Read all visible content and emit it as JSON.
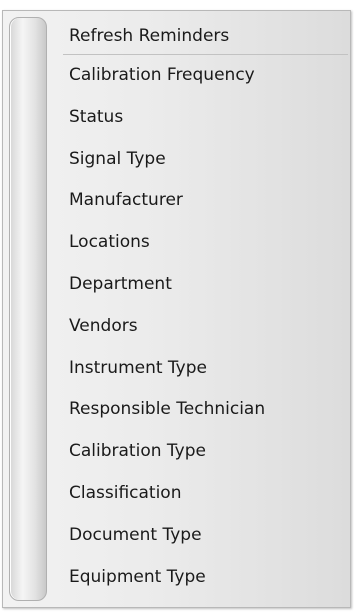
{
  "menu": {
    "items": [
      {
        "label": "Refresh Reminders"
      },
      {
        "label": "Calibration Frequency"
      },
      {
        "label": "Status"
      },
      {
        "label": "Signal Type"
      },
      {
        "label": "Manufacturer"
      },
      {
        "label": "Locations"
      },
      {
        "label": "Department"
      },
      {
        "label": "Vendors"
      },
      {
        "label": "Instrument Type"
      },
      {
        "label": "Responsible Technician"
      },
      {
        "label": "Calibration Type"
      },
      {
        "label": "Classification"
      },
      {
        "label": "Document Type"
      },
      {
        "label": "Equipment Type"
      }
    ]
  }
}
